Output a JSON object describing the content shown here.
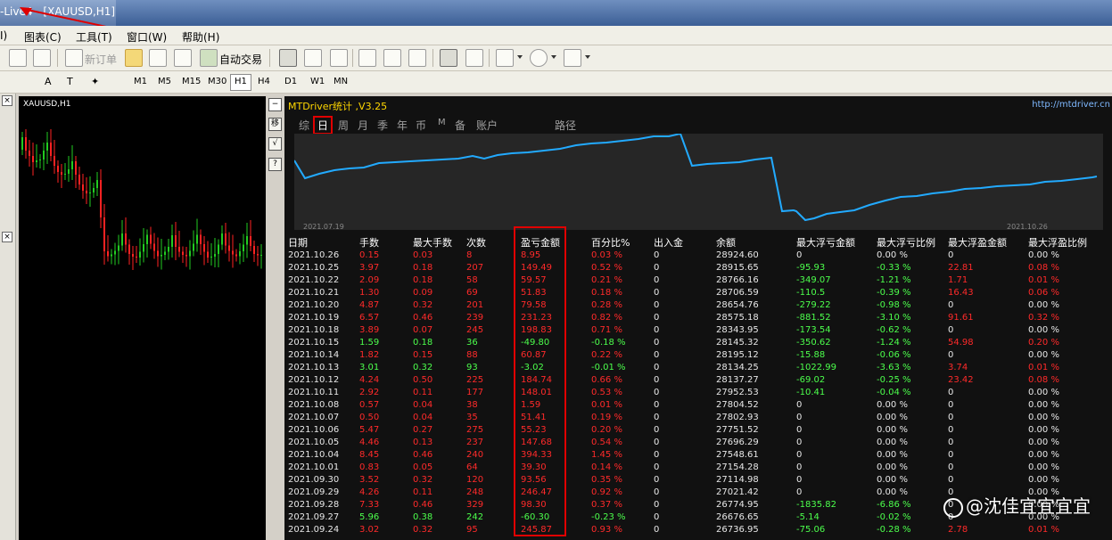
{
  "window": {
    "title": "-Live4 - [XAUUSD,H1]"
  },
  "menu": [
    "I)",
    "图表(C)",
    "工具(T)",
    "窗口(W)",
    "帮助(H)"
  ],
  "toolbar": {
    "new_order": "新订单",
    "auto_trade": "自动交易"
  },
  "timeframes": [
    "M1",
    "M5",
    "M15",
    "M30",
    "H1",
    "H4",
    "D1",
    "W1",
    "MN"
  ],
  "active_timeframe": "H1",
  "chart": {
    "label": "XAUUSD,H1"
  },
  "panel": {
    "title": "MTDriver统计 ,V3.25",
    "link": "http://mtdriver.cn",
    "tabs": [
      "综",
      "日",
      "周",
      "月",
      "季",
      "年",
      "币",
      "M",
      "备",
      "账户",
      "路径"
    ],
    "active_tab": "日",
    "equity_start_date": "2021.07.19",
    "equity_end_date": "2021.10.26",
    "side_buttons": [
      "移",
      "√",
      "?"
    ]
  },
  "table": {
    "headers": [
      "日期",
      "手数",
      "最大手数",
      "次数",
      "盈亏金额",
      "百分比%",
      "出入金",
      "余额",
      "最大浮亏金额",
      "最大浮亏比例",
      "最大浮盈金额",
      "最大浮盈比例"
    ],
    "rows": [
      [
        "2021.10.26",
        "0.15",
        "0.03",
        "8",
        "8.95",
        "0.03 %",
        "0",
        "28924.60",
        "0",
        "0.00 %",
        "0",
        "0.00 %",
        "r"
      ],
      [
        "2021.10.25",
        "3.97",
        "0.18",
        "207",
        "149.49",
        "0.52 %",
        "0",
        "28915.65",
        "-95.93",
        "-0.33 %",
        "22.81",
        "0.08 %",
        "r"
      ],
      [
        "2021.10.22",
        "2.09",
        "0.18",
        "58",
        "59.57",
        "0.21 %",
        "0",
        "28766.16",
        "-349.07",
        "-1.21 %",
        "1.71",
        "0.01 %",
        "r"
      ],
      [
        "2021.10.21",
        "1.30",
        "0.09",
        "69",
        "51.83",
        "0.18 %",
        "0",
        "28706.59",
        "-110.5",
        "-0.39 %",
        "16.43",
        "0.06 %",
        "r"
      ],
      [
        "2021.10.20",
        "4.87",
        "0.32",
        "201",
        "79.58",
        "0.28 %",
        "0",
        "28654.76",
        "-279.22",
        "-0.98 %",
        "0",
        "0.00 %",
        "r"
      ],
      [
        "2021.10.19",
        "6.57",
        "0.46",
        "239",
        "231.23",
        "0.82 %",
        "0",
        "28575.18",
        "-881.52",
        "-3.10 %",
        "91.61",
        "0.32 %",
        "r"
      ],
      [
        "2021.10.18",
        "3.89",
        "0.07",
        "245",
        "198.83",
        "0.71 %",
        "0",
        "28343.95",
        "-173.54",
        "-0.62 %",
        "0",
        "0.00 %",
        "r"
      ],
      [
        "2021.10.15",
        "1.59",
        "0.18",
        "36",
        "-49.80",
        "-0.18 %",
        "0",
        "28145.32",
        "-350.62",
        "-1.24 %",
        "54.98",
        "0.20 %",
        "g"
      ],
      [
        "2021.10.14",
        "1.82",
        "0.15",
        "88",
        "60.87",
        "0.22 %",
        "0",
        "28195.12",
        "-15.88",
        "-0.06 %",
        "0",
        "0.00 %",
        "r"
      ],
      [
        "2021.10.13",
        "3.01",
        "0.32",
        "93",
        "-3.02",
        "-0.01 %",
        "0",
        "28134.25",
        "-1022.99",
        "-3.63 %",
        "3.74",
        "0.01 %",
        "g"
      ],
      [
        "2021.10.12",
        "4.24",
        "0.50",
        "225",
        "184.74",
        "0.66 %",
        "0",
        "28137.27",
        "-69.02",
        "-0.25 %",
        "23.42",
        "0.08 %",
        "r"
      ],
      [
        "2021.10.11",
        "2.92",
        "0.11",
        "177",
        "148.01",
        "0.53 %",
        "0",
        "27952.53",
        "-10.41",
        "-0.04 %",
        "0",
        "0.00 %",
        "r"
      ],
      [
        "2021.10.08",
        "0.57",
        "0.04",
        "38",
        "1.59",
        "0.01 %",
        "0",
        "27804.52",
        "0",
        "0.00 %",
        "0",
        "0.00 %",
        "r"
      ],
      [
        "2021.10.07",
        "0.50",
        "0.04",
        "35",
        "51.41",
        "0.19 %",
        "0",
        "27802.93",
        "0",
        "0.00 %",
        "0",
        "0.00 %",
        "r"
      ],
      [
        "2021.10.06",
        "5.47",
        "0.27",
        "275",
        "55.23",
        "0.20 %",
        "0",
        "27751.52",
        "0",
        "0.00 %",
        "0",
        "0.00 %",
        "r"
      ],
      [
        "2021.10.05",
        "4.46",
        "0.13",
        "237",
        "147.68",
        "0.54 %",
        "0",
        "27696.29",
        "0",
        "0.00 %",
        "0",
        "0.00 %",
        "r"
      ],
      [
        "2021.10.04",
        "8.45",
        "0.46",
        "240",
        "394.33",
        "1.45 %",
        "0",
        "27548.61",
        "0",
        "0.00 %",
        "0",
        "0.00 %",
        "r"
      ],
      [
        "2021.10.01",
        "0.83",
        "0.05",
        "64",
        "39.30",
        "0.14 %",
        "0",
        "27154.28",
        "0",
        "0.00 %",
        "0",
        "0.00 %",
        "r"
      ],
      [
        "2021.09.30",
        "3.52",
        "0.32",
        "120",
        "93.56",
        "0.35 %",
        "0",
        "27114.98",
        "0",
        "0.00 %",
        "0",
        "0.00 %",
        "r"
      ],
      [
        "2021.09.29",
        "4.26",
        "0.11",
        "248",
        "246.47",
        "0.92 %",
        "0",
        "27021.42",
        "0",
        "0.00 %",
        "0",
        "0.00 %",
        "r"
      ],
      [
        "2021.09.28",
        "7.33",
        "0.46",
        "329",
        "98.30",
        "0.37 %",
        "0",
        "26774.95",
        "-1835.82",
        "-6.86 %",
        "0",
        "0.00 %",
        "r"
      ],
      [
        "2021.09.27",
        "5.96",
        "0.38",
        "242",
        "-60.30",
        "-0.23 %",
        "0",
        "26676.65",
        "-5.14",
        "-0.02 %",
        "0",
        "0.00 %",
        "g"
      ],
      [
        "2021.09.24",
        "3.02",
        "0.32",
        "95",
        "245.87",
        "0.93 %",
        "0",
        "26736.95",
        "-75.06",
        "-0.28 %",
        "2.78",
        "0.01 %",
        "r"
      ]
    ]
  },
  "watermark": "@沈佳宜宜宜宜",
  "colors": {
    "profit": "#ff2a2a",
    "loss": "#4cff4c",
    "equity_line": "#22aaff",
    "highlight": "#e00000"
  }
}
